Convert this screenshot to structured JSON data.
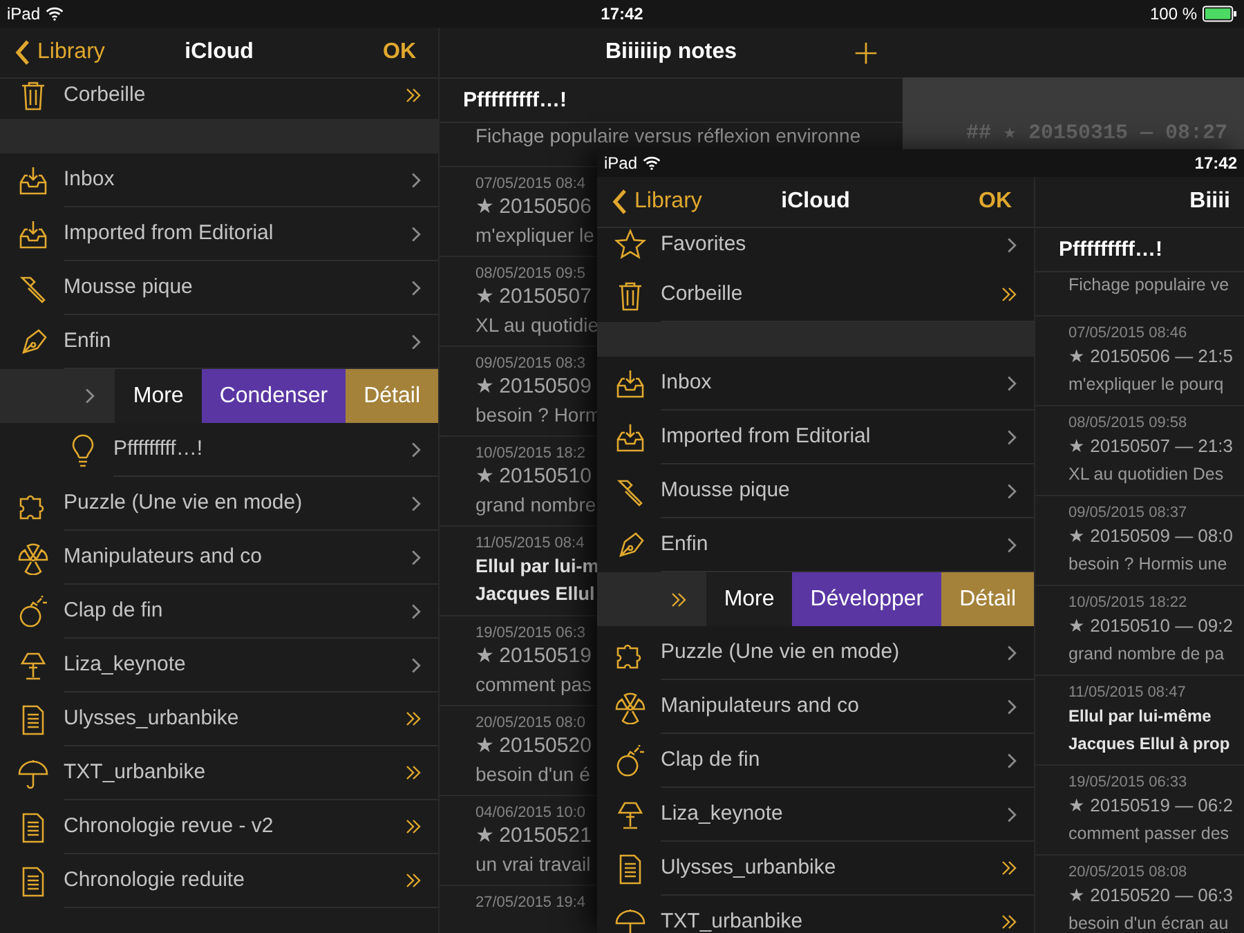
{
  "status_bar": {
    "device": "iPad",
    "time": "17:42",
    "battery": "100 %"
  },
  "library": {
    "back": "Library",
    "title": "iCloud",
    "done": "OK",
    "items": [
      {
        "label": "Corbeille",
        "kind": "trash",
        "accessory": {
          "kind": "double"
        }
      },
      {
        "kind": "divider"
      },
      {
        "label": "Inbox",
        "kind": "inbox",
        "accessory": {
          "kind": "chevron"
        }
      },
      {
        "label": "Imported from Editorial",
        "kind": "inbox",
        "accessory": {
          "kind": "chevron"
        }
      },
      {
        "label": "Mousse pique",
        "kind": "hammer",
        "accessory": {
          "kind": "chevron"
        }
      },
      {
        "label": "Enfin",
        "kind": "pen",
        "accessory": {
          "kind": "chevron"
        }
      },
      {
        "kind": "swiped",
        "accessory": {
          "kind": "chevron"
        },
        "actions": [
          {
            "label": "More",
            "kind": "more"
          },
          {
            "label": "Condenser",
            "kind": "toggle"
          },
          {
            "label": "Détail",
            "kind": "detail"
          }
        ],
        "children": [
          {
            "label": "Pfffffffff…!",
            "kind": "idea",
            "accessory": {
              "kind": "chevron"
            }
          }
        ]
      },
      {
        "label": "Puzzle (Une vie en mode)",
        "kind": "puzzle",
        "accessory": {
          "kind": "chevron"
        }
      },
      {
        "label": "Manipulateurs and co",
        "kind": "trefoil",
        "accessory": {
          "kind": "chevron"
        }
      },
      {
        "label": "Clap de fin",
        "kind": "bomb",
        "accessory": {
          "kind": "chevron"
        }
      },
      {
        "label": "Liza_keynote",
        "kind": "lamp",
        "accessory": {
          "kind": "chevron"
        }
      },
      {
        "label": "Ulysses_urbanbike",
        "kind": "document",
        "accessory": {
          "kind": "double"
        }
      },
      {
        "label": "TXT_urbanbike",
        "kind": "umbrella",
        "accessory": {
          "kind": "double"
        }
      },
      {
        "label": "Chronologie revue - v2",
        "kind": "document",
        "accessory": {
          "kind": "double"
        }
      },
      {
        "label": "Chronologie reduite",
        "kind": "document",
        "accessory": {
          "kind": "double"
        }
      }
    ]
  },
  "notes": {
    "title": "Biiiiiip notes",
    "group": "Pfffffffff…!",
    "items": [
      {
        "kind": "entry",
        "line_2": "Fichage populaire versus réflexion environne"
      },
      {
        "kind": "entry",
        "date": "07/05/2015 08:4",
        "line_1": "★ 20150506",
        "line_2": "m'expliquer le"
      },
      {
        "kind": "entry",
        "date": "08/05/2015 09:5",
        "line_1": "★ 20150507",
        "line_2": "XL au quotidie"
      },
      {
        "kind": "entry",
        "date": "09/05/2015 08:3",
        "line_1": "★ 20150509",
        "line_2": "besoin ? Horm"
      },
      {
        "kind": "entry",
        "date": "10/05/2015 18:2",
        "line_1": "★ 20150510",
        "line_2": "grand nombre"
      },
      {
        "kind": "heading",
        "date": "11/05/2015 08:4",
        "line_1": "Ellul par lui-m",
        "line_2": "Jacques Ellul"
      },
      {
        "kind": "entry",
        "date": "19/05/2015 06:3",
        "line_1": "★ 20150519",
        "line_2": "comment pas"
      },
      {
        "kind": "entry",
        "date": "20/05/2015 08:0",
        "line_1": "★ 20150520",
        "line_2": "besoin d'un é"
      },
      {
        "kind": "entry",
        "date": "04/06/2015 10:0",
        "line_1": "★ 20150521",
        "line_2": "un vrai travail"
      },
      {
        "date": "27/05/2015 19:4"
      }
    ]
  },
  "editor": {
    "text": "## ★ 20150315 — 08:27"
  },
  "inset": {
    "status_bar": {
      "device": "iPad",
      "time": "17:42"
    },
    "library": {
      "back": "Library",
      "title": "iCloud",
      "done": "OK",
      "items": [
        {
          "label": "Favorites",
          "kind": "favorites",
          "accessory": {
            "kind": "chevron"
          }
        },
        {
          "label": "Corbeille",
          "kind": "trash",
          "accessory": {
            "kind": "double"
          }
        },
        {
          "kind": "divider"
        },
        {
          "label": "Inbox",
          "kind": "inbox",
          "accessory": {
            "kind": "chevron"
          }
        },
        {
          "label": "Imported from Editorial",
          "kind": "inbox",
          "accessory": {
            "kind": "chevron"
          }
        },
        {
          "label": "Mousse pique",
          "kind": "hammer",
          "accessory": {
            "kind": "chevron"
          }
        },
        {
          "label": "Enfin",
          "kind": "pen",
          "accessory": {
            "kind": "chevron"
          }
        },
        {
          "kind": "swiped",
          "accessory": {
            "kind": "double"
          },
          "actions": [
            {
              "label": "More",
              "kind": "more"
            },
            {
              "label": "Développer",
              "kind": "toggle"
            },
            {
              "label": "Détail",
              "kind": "detail"
            }
          ]
        },
        {
          "label": "Puzzle (Une vie en mode)",
          "kind": "puzzle",
          "accessory": {
            "kind": "chevron"
          }
        },
        {
          "label": "Manipulateurs and co",
          "kind": "trefoil",
          "accessory": {
            "kind": "chevron"
          }
        },
        {
          "label": "Clap de fin",
          "kind": "bomb",
          "accessory": {
            "kind": "chevron"
          }
        },
        {
          "label": "Liza_keynote",
          "kind": "lamp",
          "accessory": {
            "kind": "chevron"
          }
        },
        {
          "label": "Ulysses_urbanbike",
          "kind": "document",
          "accessory": {
            "kind": "double"
          }
        },
        {
          "label": "TXT_urbanbike",
          "kind": "umbrella",
          "accessory": {
            "kind": "double"
          }
        }
      ]
    },
    "notes": {
      "title": "Biiii",
      "group": "Pfffffffff…!",
      "items": [
        {
          "kind": "entry",
          "line_2": "Fichage populaire ve"
        },
        {
          "kind": "entry",
          "date": "07/05/2015 08:46",
          "line_1": "★ 20150506 — 21:5",
          "line_2": "m'expliquer le pourq"
        },
        {
          "kind": "entry",
          "date": "08/05/2015 09:58",
          "line_1": "★ 20150507 — 21:3",
          "line_2": "XL au quotidien Des"
        },
        {
          "kind": "entry",
          "date": "09/05/2015 08:37",
          "line_1": "★ 20150509 — 08:0",
          "line_2": "besoin ? Hormis une"
        },
        {
          "kind": "entry",
          "date": "10/05/2015 18:22",
          "line_1": "★ 20150510 — 09:2",
          "line_2": "grand nombre de pa"
        },
        {
          "kind": "heading",
          "date": "11/05/2015 08:47",
          "line_1": "Ellul par lui-même",
          "line_2": "Jacques Ellul à prop"
        },
        {
          "kind": "entry",
          "date": "19/05/2015 06:33",
          "line_1": "★ 20150519 — 06:2",
          "line_2": "comment passer des"
        },
        {
          "kind": "entry",
          "date": "20/05/2015 08:08",
          "line_1": "★ 20150520 — 06:3",
          "line_2": "besoin d'un écran au"
        }
      ]
    }
  }
}
